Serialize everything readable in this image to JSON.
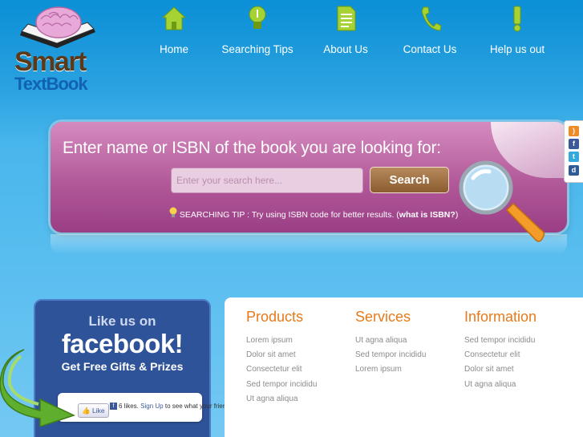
{
  "logo": {
    "line1": "Smart",
    "line2": "TextBook"
  },
  "nav": [
    {
      "label": "Home",
      "icon": "home-icon"
    },
    {
      "label": "Searching Tips",
      "icon": "lightbulb-icon"
    },
    {
      "label": "About Us",
      "icon": "document-icon"
    },
    {
      "label": "Contact Us",
      "icon": "phone-icon"
    },
    {
      "label": "Help us out",
      "icon": "exclamation-icon"
    }
  ],
  "search": {
    "headline": "Enter name or ISBN of the book you are looking for:",
    "placeholder": "Enter your search here...",
    "button": "Search",
    "tip_prefix": "SEARCHING TIP : Try using ISBN code for better results. (",
    "tip_link": "what is ISBN?",
    "tip_suffix": ")"
  },
  "social": [
    {
      "icon": "rss-icon",
      "color": "#f08a24"
    },
    {
      "icon": "facebook-icon",
      "color": "#3b5998"
    },
    {
      "icon": "twitter-icon",
      "color": "#33aadd"
    },
    {
      "icon": "delicious-icon",
      "color": "#2f5a96"
    }
  ],
  "facebook": {
    "line1": "Like us on",
    "line2": "facebook!",
    "line3": "Get Free Gifts & Prizes",
    "like_button": "Like",
    "likes_text": "6 likes.",
    "signup": "Sign Up",
    "signup_suffix": "to see what your friends like."
  },
  "columns": [
    {
      "title": "Products",
      "links": [
        "Lorem ipsum",
        "Dolor sit amet",
        "Consectetur elit",
        "Sed tempor incididu",
        "Ut agna aliqua"
      ]
    },
    {
      "title": "Services",
      "links": [
        "Ut agna aliqua",
        "Sed tempor incididu",
        "Lorem ipsum"
      ]
    },
    {
      "title": "Information",
      "links": [
        "Sed tempor incididu",
        "Consectetur elit",
        "Dolor sit amet",
        "Ut agna aliqua"
      ]
    }
  ],
  "colors": {
    "accent": "#e67a1a",
    "search_bg": "#b25999",
    "nav_icon": "#a6d233",
    "fb_blue": "#2f5398"
  }
}
